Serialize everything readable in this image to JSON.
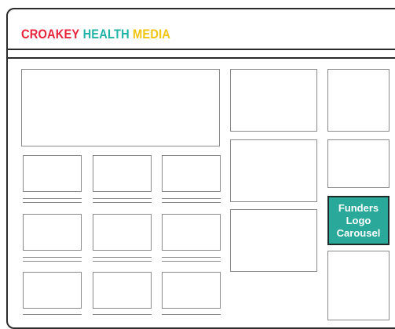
{
  "header": {
    "logo_word1": "CROAKEY",
    "logo_word2": "HEALTH",
    "logo_word3": "MEDIA"
  },
  "sidebar": {
    "funders_label": "Funders Logo Carousel"
  },
  "colors": {
    "logo_red": "#e8233c",
    "logo_teal": "#1fb3a6",
    "logo_yellow": "#f1c40f",
    "funders_bg": "#2aa89a",
    "frame": "#2b2b2b",
    "placeholder_border": "#8a8a8a"
  }
}
